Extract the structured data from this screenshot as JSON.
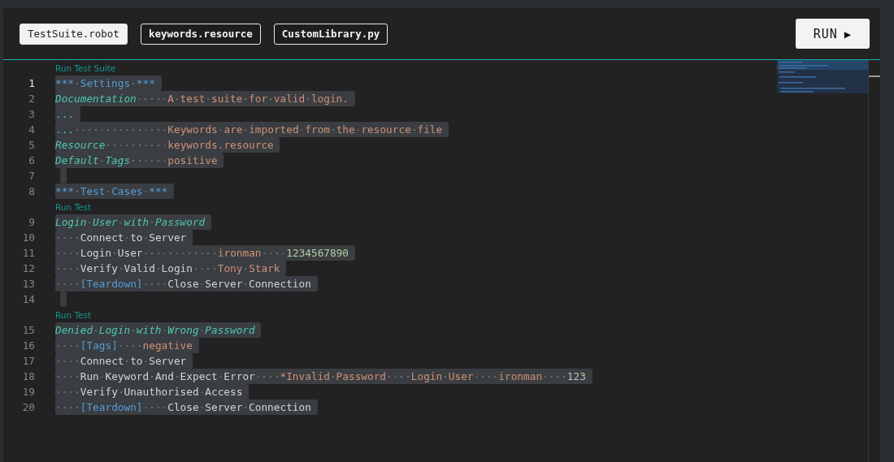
{
  "tabs": [
    {
      "label": "TestSuite.robot",
      "selected": true
    },
    {
      "label": "keywords.resource",
      "selected": false
    },
    {
      "label": "CustomLibrary.py",
      "selected": false
    }
  ],
  "run_button": {
    "label": "RUN",
    "icon": "▶"
  },
  "editor": {
    "lines": [
      {
        "kind": "lens",
        "text": "Run Test Suite"
      },
      {
        "kind": "code",
        "number": "1",
        "current": true,
        "tokens": [
          {
            "kind": "section",
            "text": "*** Settings ***"
          }
        ]
      },
      {
        "kind": "code",
        "number": "2",
        "current": false,
        "tokens": [
          {
            "kind": "setting",
            "text": "Documentation"
          },
          {
            "kind": "string",
            "text": "     A test suite for valid login."
          }
        ]
      },
      {
        "kind": "code",
        "number": "3",
        "current": false,
        "tokens": [
          {
            "kind": "continuation",
            "text": "..."
          }
        ]
      },
      {
        "kind": "code",
        "number": "4",
        "current": false,
        "tokens": [
          {
            "kind": "continuation",
            "text": "..."
          },
          {
            "kind": "string",
            "text": "               Keywords are imported from the resource file"
          }
        ]
      },
      {
        "kind": "code",
        "number": "5",
        "current": false,
        "tokens": [
          {
            "kind": "setting",
            "text": "Resource"
          },
          {
            "kind": "string",
            "text": "          keywords.resource"
          }
        ]
      },
      {
        "kind": "code",
        "number": "6",
        "current": false,
        "tokens": [
          {
            "kind": "setting",
            "text": "Default Tags"
          },
          {
            "kind": "string",
            "text": "      positive"
          }
        ]
      },
      {
        "kind": "code",
        "number": "7",
        "current": false
      },
      {
        "kind": "code",
        "number": "8",
        "current": false,
        "tokens": [
          {
            "kind": "section",
            "text": "*** Test Cases ***"
          }
        ]
      },
      {
        "kind": "lens",
        "text": "Run Test"
      },
      {
        "kind": "code",
        "number": "9",
        "current": false,
        "tokens": [
          {
            "kind": "setting",
            "text": "Login User with Password"
          }
        ]
      },
      {
        "kind": "code",
        "number": "10",
        "current": false,
        "tokens": [
          {
            "kind": "plain",
            "text": "    Connect to Server"
          }
        ]
      },
      {
        "kind": "code",
        "number": "11",
        "current": false,
        "tokens": [
          {
            "kind": "plain",
            "text": "    Login User"
          },
          {
            "kind": "string",
            "text": "            ironman"
          },
          {
            "kind": "number",
            "text": "    1234567890"
          }
        ]
      },
      {
        "kind": "code",
        "number": "12",
        "current": false,
        "tokens": [
          {
            "kind": "plain",
            "text": "    Verify Valid Login"
          },
          {
            "kind": "string",
            "text": "    Tony Stark"
          }
        ]
      },
      {
        "kind": "code",
        "number": "13",
        "current": false,
        "tokens": [
          {
            "kind": "bracket",
            "text": "    [Teardown]"
          },
          {
            "kind": "plain",
            "text": "    Close Server Connection"
          }
        ]
      },
      {
        "kind": "code",
        "number": "14",
        "current": false
      },
      {
        "kind": "lens",
        "text": "Run Test"
      },
      {
        "kind": "code",
        "number": "15",
        "current": false,
        "tokens": [
          {
            "kind": "setting",
            "text": "Denied Login with Wrong Password"
          }
        ]
      },
      {
        "kind": "code",
        "number": "16",
        "current": false,
        "tokens": [
          {
            "kind": "bracket",
            "text": "    [Tags]"
          },
          {
            "kind": "string",
            "text": "    negative"
          }
        ]
      },
      {
        "kind": "code",
        "number": "17",
        "current": false,
        "tokens": [
          {
            "kind": "plain",
            "text": "    Connect to Server"
          }
        ]
      },
      {
        "kind": "code",
        "number": "18",
        "current": false,
        "tokens": [
          {
            "kind": "plain",
            "text": "    Run Keyword And Expect Error"
          },
          {
            "kind": "string",
            "text": "    *Invalid Password"
          },
          {
            "kind": "string",
            "text": "    Login User"
          },
          {
            "kind": "string",
            "text": "    ironman"
          },
          {
            "kind": "number",
            "text": "    123"
          }
        ]
      },
      {
        "kind": "code",
        "number": "19",
        "current": false,
        "tokens": [
          {
            "kind": "plain",
            "text": "    Verify Unauthorised Access"
          }
        ]
      },
      {
        "kind": "code",
        "number": "20",
        "current": false,
        "tokens": [
          {
            "kind": "bracket",
            "text": "    [Teardown]"
          },
          {
            "kind": "plain",
            "text": "    Close Server Connection"
          }
        ]
      }
    ]
  }
}
